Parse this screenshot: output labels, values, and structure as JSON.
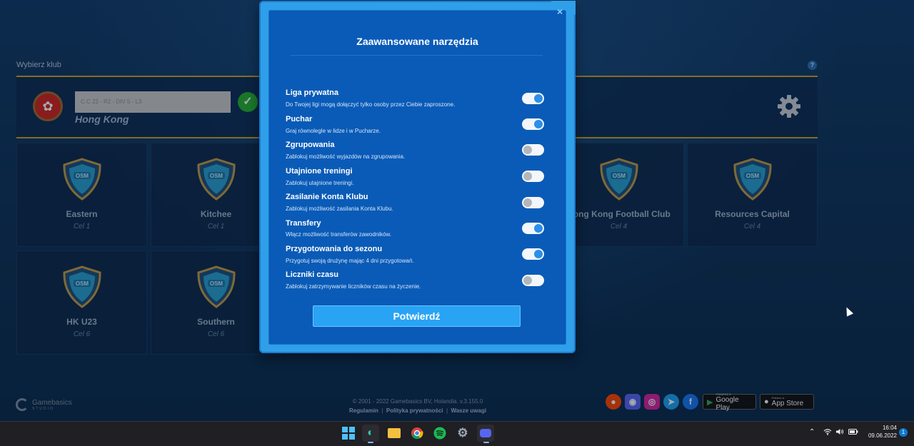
{
  "background": {
    "choose_club_label": "Wybierz klub",
    "help_icon": "?",
    "club_selector": {
      "input_value": "C.C 22 - R2 - DIV 5 - L3",
      "club_name": "Hong Kong"
    },
    "clubs": [
      {
        "name": "Eastern",
        "goal": "Cel 1"
      },
      {
        "name": "Kitchee",
        "goal": "Cel 1"
      },
      {
        "name": "Hong Kong Football Club",
        "goal": "Cel 4"
      },
      {
        "name": "Resources Capital",
        "goal": "Cel 4"
      },
      {
        "name": "HK U23",
        "goal": "Cel 6"
      },
      {
        "name": "Southern",
        "goal": "Cel 6"
      }
    ],
    "shield_text": "OSM",
    "footer": {
      "brand": "Gamebasics",
      "brand_sub": "STUDIO",
      "copyright": "© 2001 - 2022 Gamebasics BV, Holandia. v.3.155.0",
      "links": [
        "Regulamin",
        "Polityka prywatności",
        "Wasze uwagi"
      ],
      "google_play_small": "POBIERZ Z",
      "google_play": "Google Play",
      "app_store_small": "Pobierz w",
      "app_store": "App Store"
    }
  },
  "modal": {
    "title": "Zaawansowane narzędzia",
    "close_icon": "×",
    "options": [
      {
        "title": "Liga prywatna",
        "desc": "Do Twojej ligi mogą dołączyć tylko osoby przez Ciebie zaproszone.",
        "enabled": true
      },
      {
        "title": "Puchar",
        "desc": "Graj równolegle w lidze i w Pucharze.",
        "enabled": true
      },
      {
        "title": "Zgrupowania",
        "desc": "Zablokuj możliwość wyjazdów na zgrupowania.",
        "enabled": false
      },
      {
        "title": "Utajnione treningi",
        "desc": "Zablokuj utajnione treningi.",
        "enabled": false
      },
      {
        "title": "Zasilanie Konta Klubu",
        "desc": "Zablokuj możliwość zasilania Konta Klubu.",
        "enabled": false
      },
      {
        "title": "Transfery",
        "desc": "Włącz możliwość transferów zawodników.",
        "enabled": true
      },
      {
        "title": "Przygotowania do sezonu",
        "desc": "Przygotuj swoją drużynę mając 4 dni przygotowań.",
        "enabled": true
      },
      {
        "title": "Liczniki czasu",
        "desc": "Zablokuj zatrzymywanie liczników czasu na życzenie.",
        "enabled": false
      }
    ],
    "confirm_label": "Potwierdź"
  },
  "taskbar": {
    "time": "16:04",
    "date": "09.06.2022",
    "notification_count": "1"
  }
}
